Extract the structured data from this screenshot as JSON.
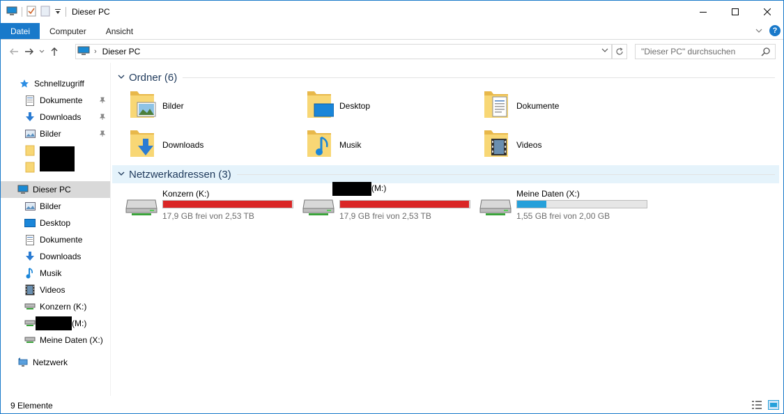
{
  "window": {
    "title": "Dieser PC"
  },
  "ribbon": {
    "file_tab": "Datei",
    "tabs": [
      "Computer",
      "Ansicht"
    ],
    "help_label": "?"
  },
  "address": {
    "location": "Dieser PC",
    "search_placeholder": "\"Dieser PC\" durchsuchen"
  },
  "sidebar": {
    "quick_access": "Schnellzugriff",
    "quick_items": [
      {
        "label": "Dokumente",
        "icon": "document-icon"
      },
      {
        "label": "Downloads",
        "icon": "download-icon"
      },
      {
        "label": "Bilder",
        "icon": "pictures-icon"
      }
    ],
    "this_pc": "Dieser PC",
    "pc_items": [
      {
        "label": "Bilder",
        "icon": "pictures-icon"
      },
      {
        "label": "Desktop",
        "icon": "desktop-icon"
      },
      {
        "label": "Dokumente",
        "icon": "document-icon"
      },
      {
        "label": "Downloads",
        "icon": "download-icon"
      },
      {
        "label": "Musik",
        "icon": "music-icon"
      },
      {
        "label": "Videos",
        "icon": "video-icon"
      },
      {
        "label": "Konzern (K:)",
        "icon": "network-drive-icon"
      },
      {
        "label": "(M:)",
        "icon": "network-drive-icon"
      },
      {
        "label": "Meine Daten (X:)",
        "icon": "network-drive-icon"
      }
    ],
    "network": "Netzwerk"
  },
  "content": {
    "folders_header": "Ordner (6)",
    "folders": [
      {
        "label": "Bilder",
        "icon": "pictures-folder-icon"
      },
      {
        "label": "Desktop",
        "icon": "desktop-folder-icon"
      },
      {
        "label": "Dokumente",
        "icon": "documents-folder-icon"
      },
      {
        "label": "Downloads",
        "icon": "downloads-folder-icon"
      },
      {
        "label": "Musik",
        "icon": "music-folder-icon"
      },
      {
        "label": "Videos",
        "icon": "videos-folder-icon"
      }
    ],
    "network_header": "Netzwerkadressen (3)",
    "drives": [
      {
        "name": "Konzern (K:)",
        "free_text": "17,9 GB frei von 2,53 TB",
        "used_fraction": 0.993,
        "bar_color": "#da2626"
      },
      {
        "name": "(M:)",
        "free_text": "17,9 GB frei von 2,53 TB",
        "used_fraction": 0.993,
        "bar_color": "#da2626"
      },
      {
        "name": "Meine Daten (X:)",
        "free_text": "1,55 GB frei von 2,00 GB",
        "used_fraction": 0.225,
        "bar_color": "#26a0da"
      }
    ]
  },
  "status": {
    "count": "9 Elemente"
  },
  "colors": {
    "accent": "#1979ca",
    "header_text": "#1e395b",
    "selected_bg": "#d9d9d9"
  }
}
